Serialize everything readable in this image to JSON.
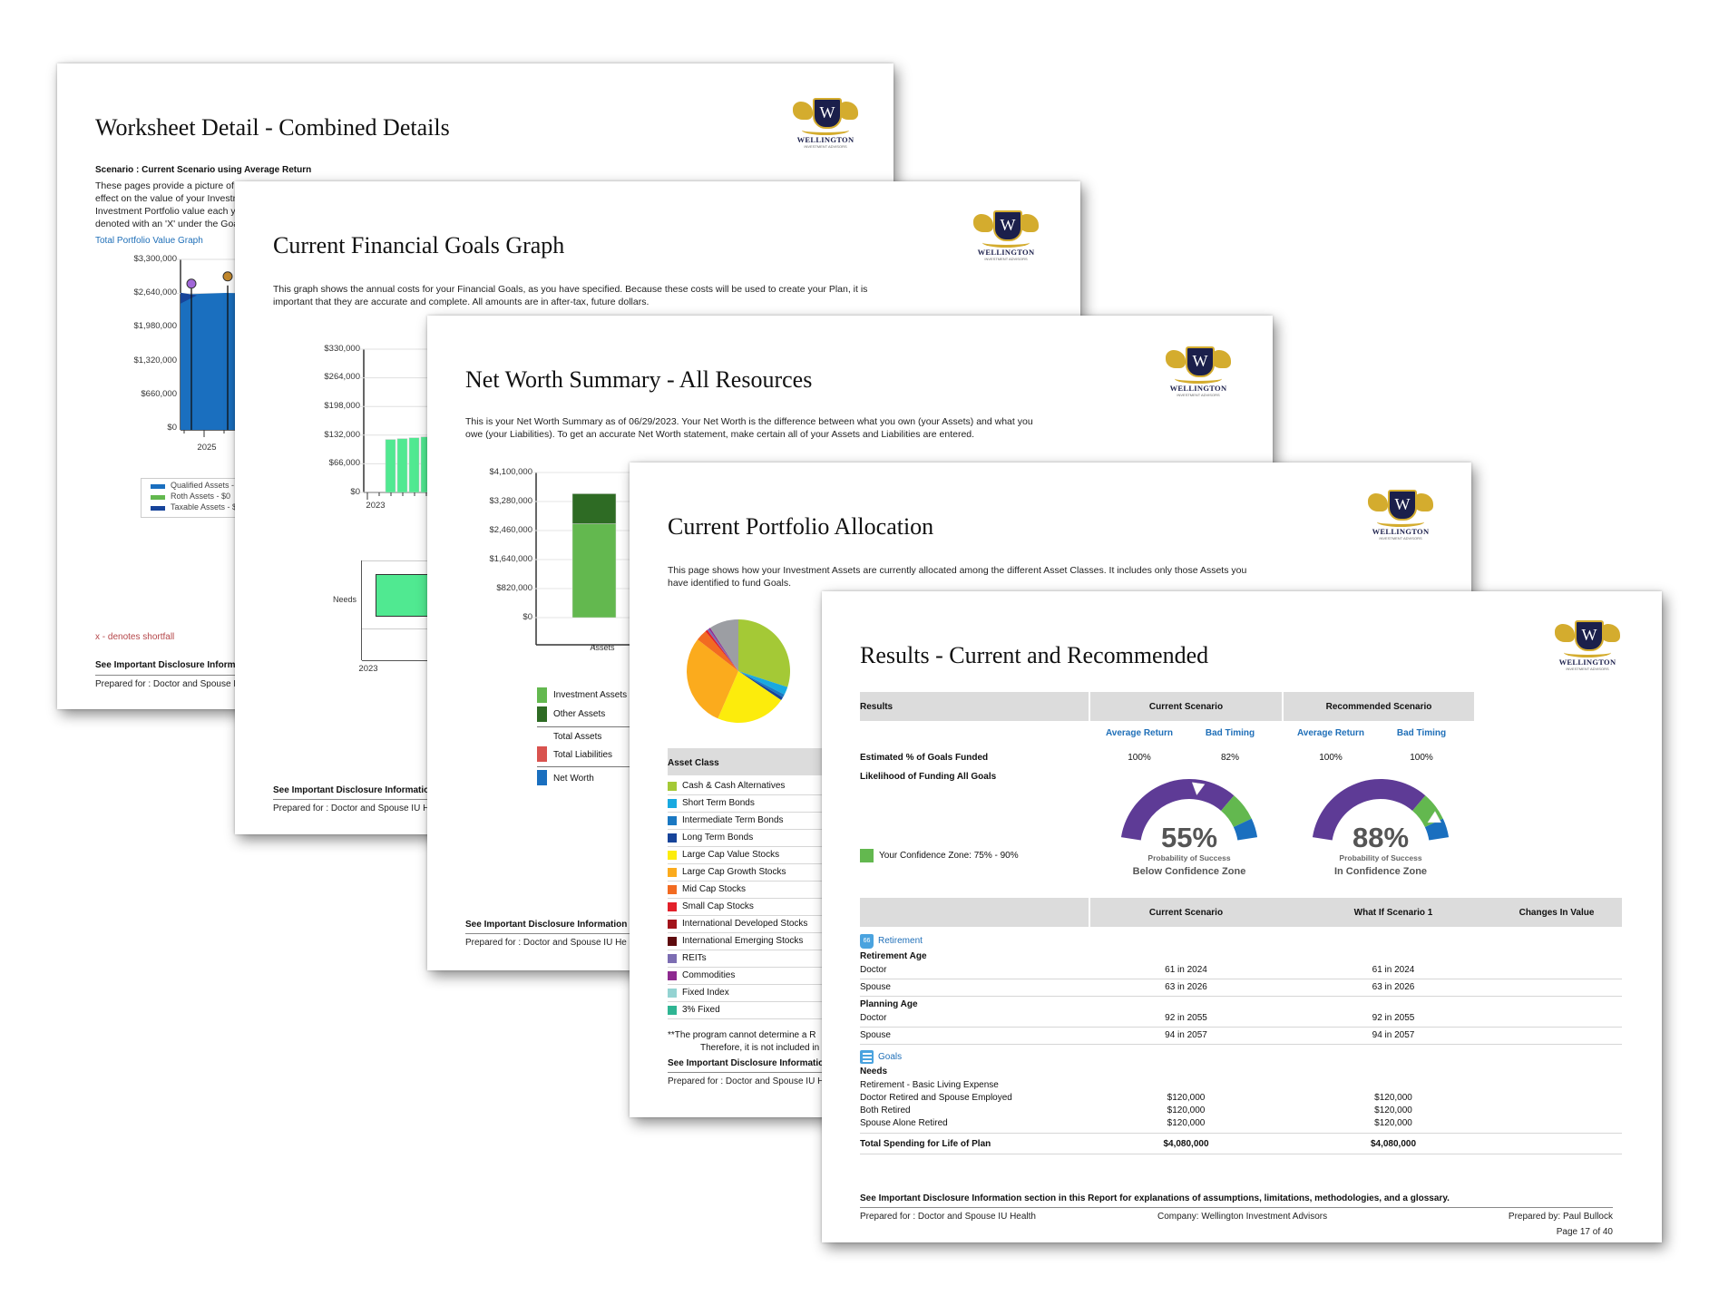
{
  "brand": {
    "logo_letter": "W",
    "logo_name": "WELLINGTON",
    "logo_sub": "INVESTMENT ADVISORS",
    "gold": "#d4ac2e",
    "navy": "#1b1f4b"
  },
  "page1": {
    "title": "Worksheet Detail - Combined Details",
    "scenario": "Scenario : Current Scenario using Average Return",
    "intro_lines": [
      "These pages provide a picture of h",
      "effect on the value of your Investm",
      "Investment Portfolio value each ye",
      "denoted with an 'X' under the Goa"
    ],
    "graph_link": "Total Portfolio Value Graph",
    "shortfall_note": "x - denotes shortfall",
    "disclosure": "See Important Disclosure Informati",
    "prepared": "Prepared for : Doctor and Spouse I",
    "legend": [
      "Qualified Assets -",
      "Roth Assets - $0",
      "Taxable Assets - $"
    ]
  },
  "page2": {
    "title": "Current Financial Goals Graph",
    "intro_lines": [
      "This graph shows the annual costs for your Financial Goals, as you have specified.  Because these costs will be used to create your Plan, it is",
      "important that they are accurate and complete. All amounts are in after-tax, future dollars."
    ],
    "timeline_label": "Needs",
    "timeline_year": "2023",
    "disclosure": "See Important Disclosure Information",
    "prepared": "Prepared for : Doctor and Spouse IU H"
  },
  "page3": {
    "title": "Net Worth Summary - All Resources",
    "intro_lines": [
      "This is your Net Worth Summary as of 06/29/2023. Your Net Worth is the difference between what you own (your Assets) and what you",
      "owe (your Liabilities). To get an accurate Net Worth statement, make certain all of your Assets and Liabilities are entered."
    ],
    "legend": [
      {
        "label": "Investment Assets",
        "color": "#63b84f"
      },
      {
        "label": "Other Assets",
        "color": "#2e6b24"
      },
      {
        "label": "Total Assets",
        "color": ""
      },
      {
        "label": "Total Liabilities",
        "color": "#d9534f"
      },
      {
        "label": "Net Worth",
        "color": "#1a6fbf"
      }
    ],
    "disclosure": "See Important Disclosure Information se",
    "prepared": "Prepared for : Doctor and Spouse IU He"
  },
  "page4": {
    "title": "Current Portfolio Allocation",
    "intro_lines": [
      "This page shows how your Investment Assets are currently allocated among the different Asset Classes.  It includes only those Assets you",
      "have identified to fund Goals."
    ],
    "table_header": "Asset Class",
    "asset_classes": [
      {
        "label": "Cash & Cash Alternatives",
        "color": "#a4c936"
      },
      {
        "label": "Short Term Bonds",
        "color": "#19a9e0"
      },
      {
        "label": "Intermediate Term Bonds",
        "color": "#1a78c2"
      },
      {
        "label": "Long Term Bonds",
        "color": "#17449a"
      },
      {
        "label": "Large Cap Value Stocks",
        "color": "#fcec0c"
      },
      {
        "label": "Large Cap Growth Stocks",
        "color": "#fbab1d"
      },
      {
        "label": "Mid Cap Stocks",
        "color": "#f26b21"
      },
      {
        "label": "Small Cap Stocks",
        "color": "#e2202a"
      },
      {
        "label": "International Developed Stocks",
        "color": "#a2131b"
      },
      {
        "label": "International Emerging Stocks",
        "color": "#5e0b0e"
      },
      {
        "label": "REITs",
        "color": "#7c6db2"
      },
      {
        "label": "Commodities",
        "color": "#8e2a90"
      },
      {
        "label": "Fixed Index",
        "color": "#94d3d2"
      },
      {
        "label": "3% Fixed",
        "color": "#2fb593"
      }
    ],
    "footnote_lines": [
      "**The program cannot determine a R",
      "Therefore, it is not included in"
    ],
    "disclosure": "See Important Disclosure Information :",
    "prepared": "Prepared for : Doctor and Spouse IU H"
  },
  "page5": {
    "title": "Results - Current and Recommended",
    "results_header": {
      "label": "Results",
      "current": "Current Scenario",
      "recommended": "Recommended Scenario"
    },
    "sub_labels": {
      "avg": "Average Return",
      "bad": "Bad Timing"
    },
    "row_labels": [
      "Estimated % of Goals Funded",
      "Likelihood of Funding All Goals"
    ],
    "current": {
      "avg_pct": "100%",
      "bad_pct": "82%",
      "probability": "55%",
      "probability_value": 55,
      "prob_label": "Probability of Success",
      "zone_text": "Below Confidence Zone"
    },
    "recommended": {
      "avg_pct": "100%",
      "bad_pct": "100%",
      "probability": "88%",
      "probability_value": 88,
      "prob_label": "Probability of Success",
      "zone_text": "In Confidence Zone"
    },
    "confidence_zone": {
      "label": "Your Confidence Zone: 75% - 90%",
      "low": 75,
      "high": 90,
      "color": "#63b84f"
    },
    "gauge_colors": {
      "below": "#5e3b96",
      "zone": "#63b84f",
      "above": "#1a6fbf"
    },
    "compare_header": {
      "current": "Current Scenario",
      "whatif": "What If Scenario 1",
      "changes": "Changes In Value"
    },
    "retirement": {
      "section": "Retirement",
      "icon_text": "66",
      "retirement_age_label": "Retirement Age",
      "retirement_age": [
        {
          "label": "Doctor",
          "current": "61 in 2024",
          "whatif": "61 in 2024"
        },
        {
          "label": "Spouse",
          "current": "63 in 2026",
          "whatif": "63 in 2026"
        }
      ],
      "planning_age_label": "Planning Age",
      "planning_age": [
        {
          "label": "Doctor",
          "current": "92 in 2055",
          "whatif": "92 in 2055"
        },
        {
          "label": "Spouse",
          "current": "94 in 2057",
          "whatif": "94 in 2057"
        }
      ]
    },
    "goals": {
      "section": "Goals",
      "needs_label": "Needs",
      "goal_name": "Retirement - Basic Living Expense",
      "rows": [
        {
          "label": "Doctor Retired and Spouse Employed",
          "current": "$120,000",
          "whatif": "$120,000"
        },
        {
          "label": "Both Retired",
          "current": "$120,000",
          "whatif": "$120,000"
        },
        {
          "label": "Spouse Alone Retired",
          "current": "$120,000",
          "whatif": "$120,000"
        }
      ],
      "total": {
        "label": "Total Spending for Life of Plan",
        "current": "$4,080,000",
        "whatif": "$4,080,000"
      }
    },
    "disclosure": "See Important Disclosure Information section in this Report for explanations of assumptions, limitations, methodologies, and a glossary.",
    "prepared_for": "Prepared for : Doctor and Spouse IU Health",
    "company": "Company: Wellington Investment Advisors",
    "prepared_by": "Prepared by: Paul Bullock",
    "page_number": "Page 17 of 40"
  },
  "chart_data": [
    {
      "type": "area",
      "title": "Total Portfolio Value Graph",
      "yticks": [
        "$3,300,000",
        "$2,640,000",
        "$1,980,000",
        "$1,320,000",
        "$660,000",
        "$0"
      ],
      "ylim": [
        0,
        3300000
      ],
      "xticks": [
        "2025"
      ],
      "series": [
        {
          "name": "Qualified Assets",
          "color": "#1a6fbf",
          "values": [
            2620000,
            2650000,
            2640000,
            2560000,
            2480000
          ]
        }
      ],
      "markers": [
        {
          "x_index": 1,
          "color": "#a066d8"
        },
        {
          "x_index": 3,
          "color": "#c4892c"
        }
      ]
    },
    {
      "type": "bar",
      "title": "Current Financial Goals Graph",
      "yticks": [
        "$330,000",
        "$264,000",
        "$198,000",
        "$132,000",
        "$66,000",
        "$0"
      ],
      "ylim": [
        0,
        330000
      ],
      "xticks": [
        "2023"
      ],
      "color": "#50e991",
      "values": [
        122000,
        124000,
        126000,
        128000
      ]
    },
    {
      "type": "bar",
      "title": "Net Worth Summary",
      "yticks": [
        "$4,100,000",
        "$3,280,000",
        "$2,460,000",
        "$1,640,000",
        "$820,000",
        "$0"
      ],
      "ylim": [
        0,
        4100000
      ],
      "categories": [
        "Assets"
      ],
      "series": [
        {
          "name": "Investment Assets",
          "color": "#63b84f",
          "values": [
            2650000
          ]
        },
        {
          "name": "Other Assets",
          "color": "#2e6b24",
          "values": [
            850000
          ]
        }
      ]
    },
    {
      "type": "pie",
      "title": "Current Portfolio Allocation",
      "slices": [
        {
          "label": "Cash & Cash Alternatives",
          "value": 30,
          "color": "#a4c936"
        },
        {
          "label": "Short Term Bonds",
          "value": 2.5,
          "color": "#19a9e0"
        },
        {
          "label": "Intermediate Term Bonds",
          "value": 1,
          "color": "#1a78c2"
        },
        {
          "label": "Long Term Bonds",
          "value": 1,
          "color": "#17449a"
        },
        {
          "label": "Large Cap Value Stocks",
          "value": 22,
          "color": "#fcec0c"
        },
        {
          "label": "Large Cap Growth Stocks",
          "value": 29,
          "color": "#fbab1d"
        },
        {
          "label": "Mid Cap Stocks",
          "value": 3.5,
          "color": "#f26b21"
        },
        {
          "label": "Small Cap Stocks",
          "value": 0.7,
          "color": "#e2202a"
        },
        {
          "label": "REITs",
          "value": 0.6,
          "color": "#7c6db2"
        },
        {
          "label": "Commodities",
          "value": 0.5,
          "color": "#8e2a90"
        },
        {
          "label": "Other",
          "value": 9.2,
          "color": "#9c9ea3"
        }
      ]
    }
  ]
}
